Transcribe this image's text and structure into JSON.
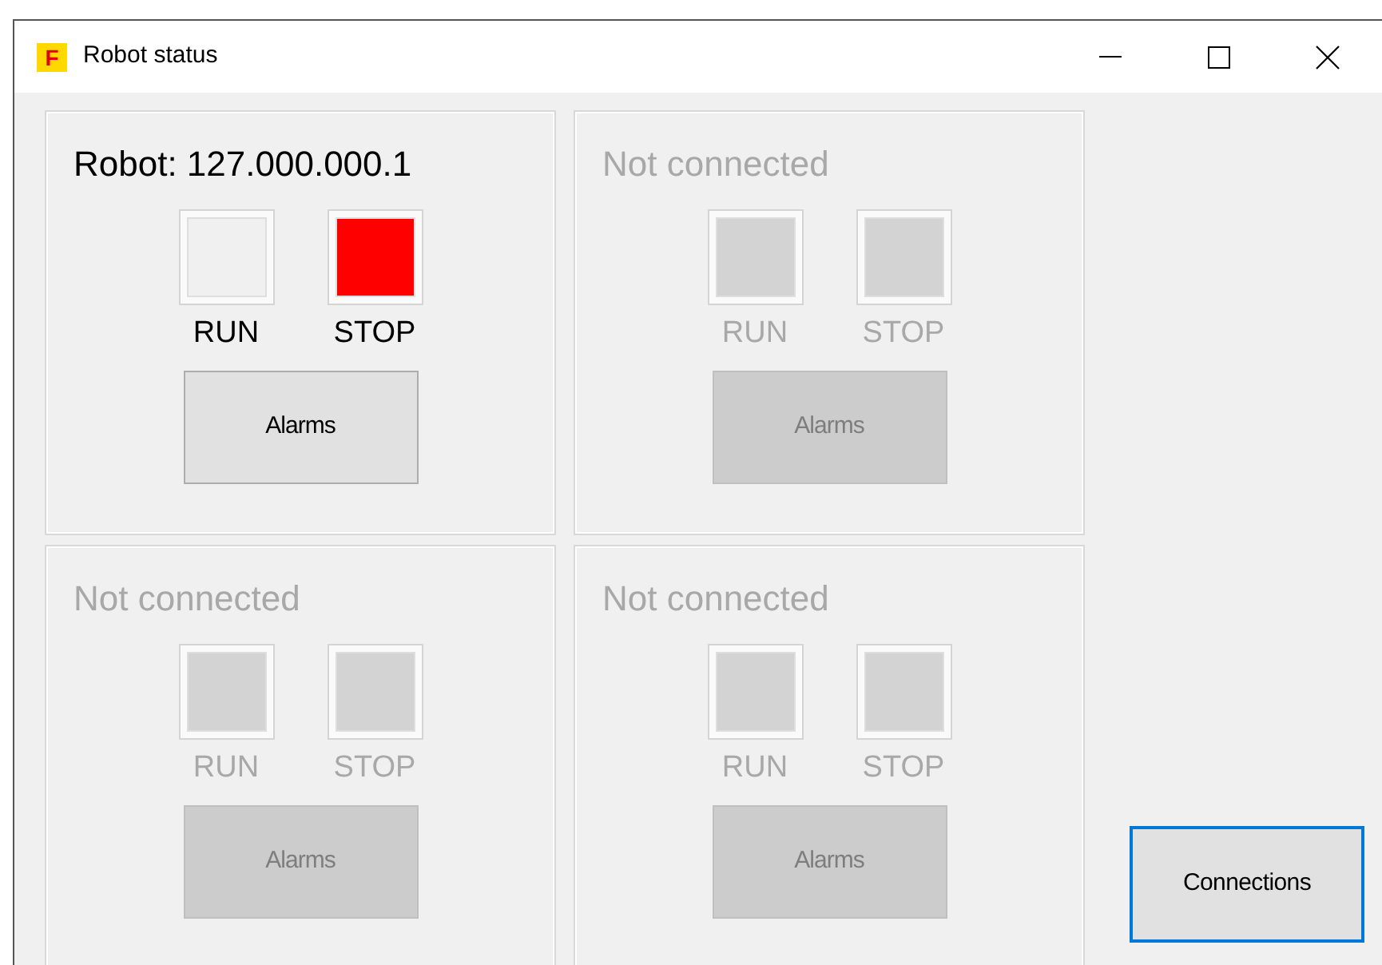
{
  "window": {
    "title": "Robot status",
    "app_icon": "F"
  },
  "panels": [
    {
      "title": "Robot: 127.000.000.1",
      "disabled": false,
      "lamps": [
        {
          "label": "RUN",
          "on": false
        },
        {
          "label": "STOP",
          "on": true,
          "color": "#ff0000"
        }
      ],
      "button": "Alarms"
    },
    {
      "title": "Not connected",
      "disabled": true,
      "lamps": [
        {
          "label": "RUN",
          "on": false
        },
        {
          "label": "STOP",
          "on": false
        }
      ],
      "button": "Alarms"
    },
    {
      "title": "Not connected",
      "disabled": true,
      "lamps": [
        {
          "label": "RUN",
          "on": false
        },
        {
          "label": "STOP",
          "on": false
        }
      ],
      "button": "Alarms"
    },
    {
      "title": "Not connected",
      "disabled": true,
      "lamps": [
        {
          "label": "RUN",
          "on": false
        },
        {
          "label": "STOP",
          "on": false
        }
      ],
      "button": "Alarms"
    }
  ],
  "connections_button": {
    "label": "Connections",
    "focused": true
  }
}
